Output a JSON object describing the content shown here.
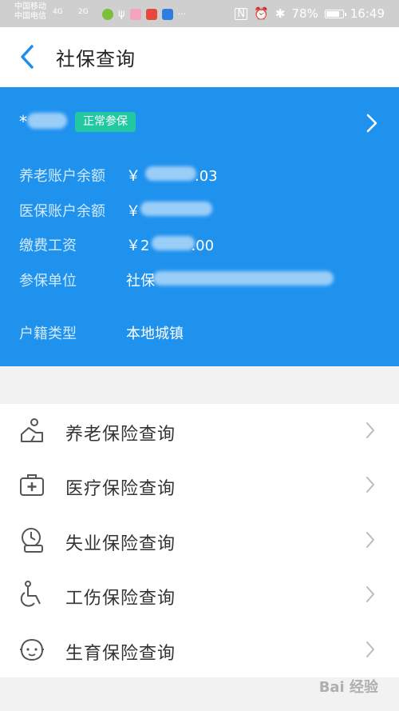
{
  "status_bar": {
    "carrier1": "中国移动",
    "carrier2": "中国电信",
    "sig1": "4G",
    "sig2": "2G",
    "battery": "78%",
    "time": "16:49",
    "more": "···"
  },
  "header": {
    "title": "社保查询"
  },
  "card": {
    "name": "*",
    "badge": "正常参保",
    "rows": [
      {
        "label": "养老账户余额",
        "value": "￥",
        "value_tail": ".03"
      },
      {
        "label": "医保账户余额",
        "value": "￥",
        "value_tail": ""
      },
      {
        "label": "缴费工资",
        "value": "￥2",
        "value_tail": ".00"
      },
      {
        "label": "参保单位",
        "value": "社保",
        "value_tail": ""
      },
      {
        "label": "户籍类型",
        "value": "本地城镇",
        "value_tail": ""
      }
    ]
  },
  "menu": {
    "items": [
      {
        "label": "养老保险查询",
        "icon": "elderly-icon"
      },
      {
        "label": "医疗保险查询",
        "icon": "medical-kit-icon"
      },
      {
        "label": "失业保险查询",
        "icon": "unemployment-icon"
      },
      {
        "label": "工伤保险查询",
        "icon": "wheelchair-icon"
      },
      {
        "label": "生育保险查询",
        "icon": "baby-icon"
      }
    ]
  },
  "watermark": "Bai 经验"
}
